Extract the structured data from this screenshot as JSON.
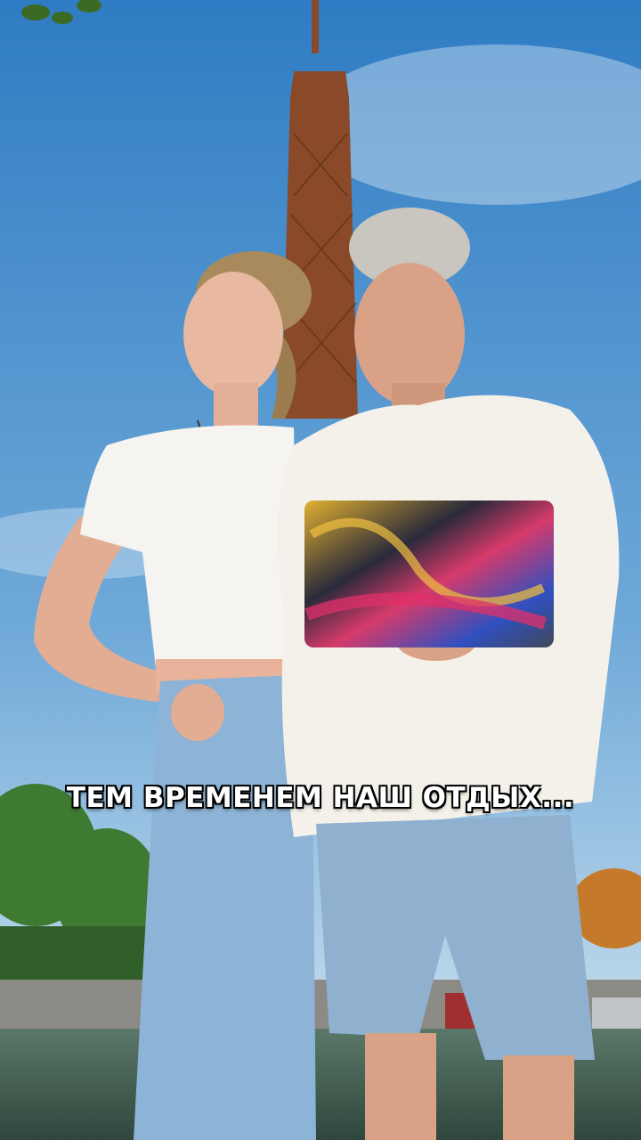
{
  "caption": {
    "text": "ТЕМ ВРЕМЕНЕМ НАШ ОТДЫХ..."
  },
  "colors": {
    "sky_top": "#3d86c9",
    "sky_bottom": "#cfe3f0",
    "tower": "#8a4a2a",
    "shirt": "#f4f1ea",
    "denim": "#8db3d6",
    "water": "#4d6b5e",
    "trees": "#3e7a32"
  },
  "icons": [
    "eiffel-tower-icon",
    "laptop-icon"
  ]
}
